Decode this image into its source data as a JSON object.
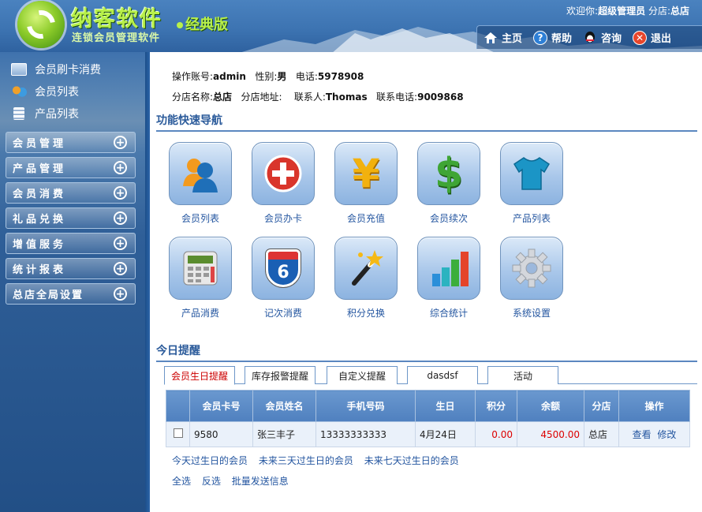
{
  "header": {
    "logo_title": "纳客软件",
    "logo_edition": "经典版",
    "logo_subtitle": "连锁会员管理软件",
    "welcome_prefix": "欢迎你:",
    "welcome_user": "超级管理员",
    "welcome_branch_label": "分店:",
    "welcome_branch": "总店",
    "nav": [
      {
        "label": "主页",
        "icon": "home-icon"
      },
      {
        "label": "帮助",
        "icon": "help-icon"
      },
      {
        "label": "咨询",
        "icon": "qq-chat-icon"
      },
      {
        "label": "退出",
        "icon": "exit-icon"
      }
    ]
  },
  "sidebar": {
    "quick_links": [
      {
        "label": "会员刷卡消费",
        "icon": "card-icon"
      },
      {
        "label": "会员列表",
        "icon": "users-icon"
      },
      {
        "label": "产品列表",
        "icon": "stack-icon"
      }
    ],
    "menus": [
      {
        "label": "会员管理"
      },
      {
        "label": "产品管理"
      },
      {
        "label": "会员消费"
      },
      {
        "label": "礼品兑换"
      },
      {
        "label": "增值服务"
      },
      {
        "label": "统计报表"
      },
      {
        "label": "总店全局设置"
      }
    ],
    "plus_symbol": "+"
  },
  "account": {
    "account_label": "操作账号:",
    "account": "admin",
    "gender_label": "性别:",
    "gender": "男",
    "phone_label": "电话:",
    "phone": "5978908",
    "branch_label": "分店名称:",
    "branch": "总店",
    "address_label": "分店地址:",
    "address": "",
    "contact_label": "联系人:",
    "contact": "Thomas",
    "contact_phone_label": "联系电话:",
    "contact_phone": "9009868"
  },
  "quicknav": {
    "title": "功能快速导航",
    "tiles": [
      {
        "label": "会员列表",
        "icon": "members-icon"
      },
      {
        "label": "会员办卡",
        "icon": "add-card-icon"
      },
      {
        "label": "会员充值",
        "icon": "yen-icon",
        "glyph": "¥"
      },
      {
        "label": "会员续次",
        "icon": "dollar-icon",
        "glyph": "$"
      },
      {
        "label": "产品列表",
        "icon": "tshirt-icon"
      },
      {
        "label": "产品消费",
        "icon": "calculator-icon"
      },
      {
        "label": "记次消费",
        "icon": "route-sign-icon",
        "glyph": "6"
      },
      {
        "label": "积分兑换",
        "icon": "magic-wand-icon"
      },
      {
        "label": "综合统计",
        "icon": "bar-chart-icon"
      },
      {
        "label": "系统设置",
        "icon": "gear-icon"
      }
    ]
  },
  "reminders": {
    "title": "今日提醒",
    "tabs": [
      "会员生日提醒",
      "库存报警提醒",
      "自定义提醒",
      "dasdsf",
      "活动"
    ],
    "active_tab": 0,
    "table": {
      "headers": [
        "",
        "会员卡号",
        "会员姓名",
        "手机号码",
        "生日",
        "积分",
        "余额",
        "分店",
        "操作"
      ],
      "rows": [
        {
          "card": "9580",
          "name": "张三丰子",
          "mobile": "13333333333",
          "birthday": "4月24日",
          "points": "0.00",
          "balance": "4500.00",
          "branch": "总店",
          "view": "查看",
          "edit": "修改"
        }
      ]
    },
    "filter_links": [
      "今天过生日的会员",
      "未来三天过生日的会员",
      "未来七天过生日的会员"
    ],
    "action_links": [
      "全选",
      "反选",
      "批量发送信息"
    ]
  },
  "colors": {
    "header_blue": "#3d74b2",
    "logo_green": "#b8f04a",
    "link_blue": "#2456a0",
    "amount_red": "#dd0000",
    "active_tab_red": "#cc0000"
  }
}
